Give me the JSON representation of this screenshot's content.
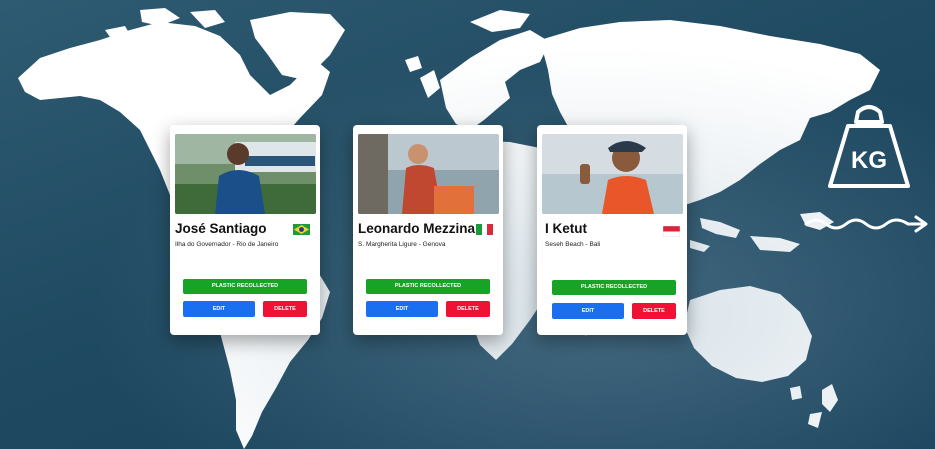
{
  "cards": [
    {
      "name": "José Santiago",
      "location": "Ilha do Governador - Rio de Janeiro",
      "flag_icon": "brazil-flag-icon",
      "plastic_label": "PLASTIC RECOLLECTED",
      "edit_label": "EDIT",
      "delete_label": "DELETE"
    },
    {
      "name": "Leonardo Mezzina",
      "location": "S. Margherita Ligure - Genova",
      "flag_icon": "italy-flag-icon",
      "plastic_label": "PLASTIC RECOLLECTED",
      "edit_label": "EDIT",
      "delete_label": "DELETE"
    },
    {
      "name": "I Ketut",
      "location": "Seseh Beach - Bali",
      "flag_icon": "indonesia-flag-icon",
      "plastic_label": "PLASTIC RECOLLECTED",
      "edit_label": "EDIT",
      "delete_label": "DELETE"
    }
  ],
  "weight_icon": {
    "label": "KG"
  },
  "colors": {
    "background": "#1f4a61",
    "plastic_button": "#17a325",
    "edit_button": "#1a6ff0",
    "delete_button": "#f01234"
  }
}
